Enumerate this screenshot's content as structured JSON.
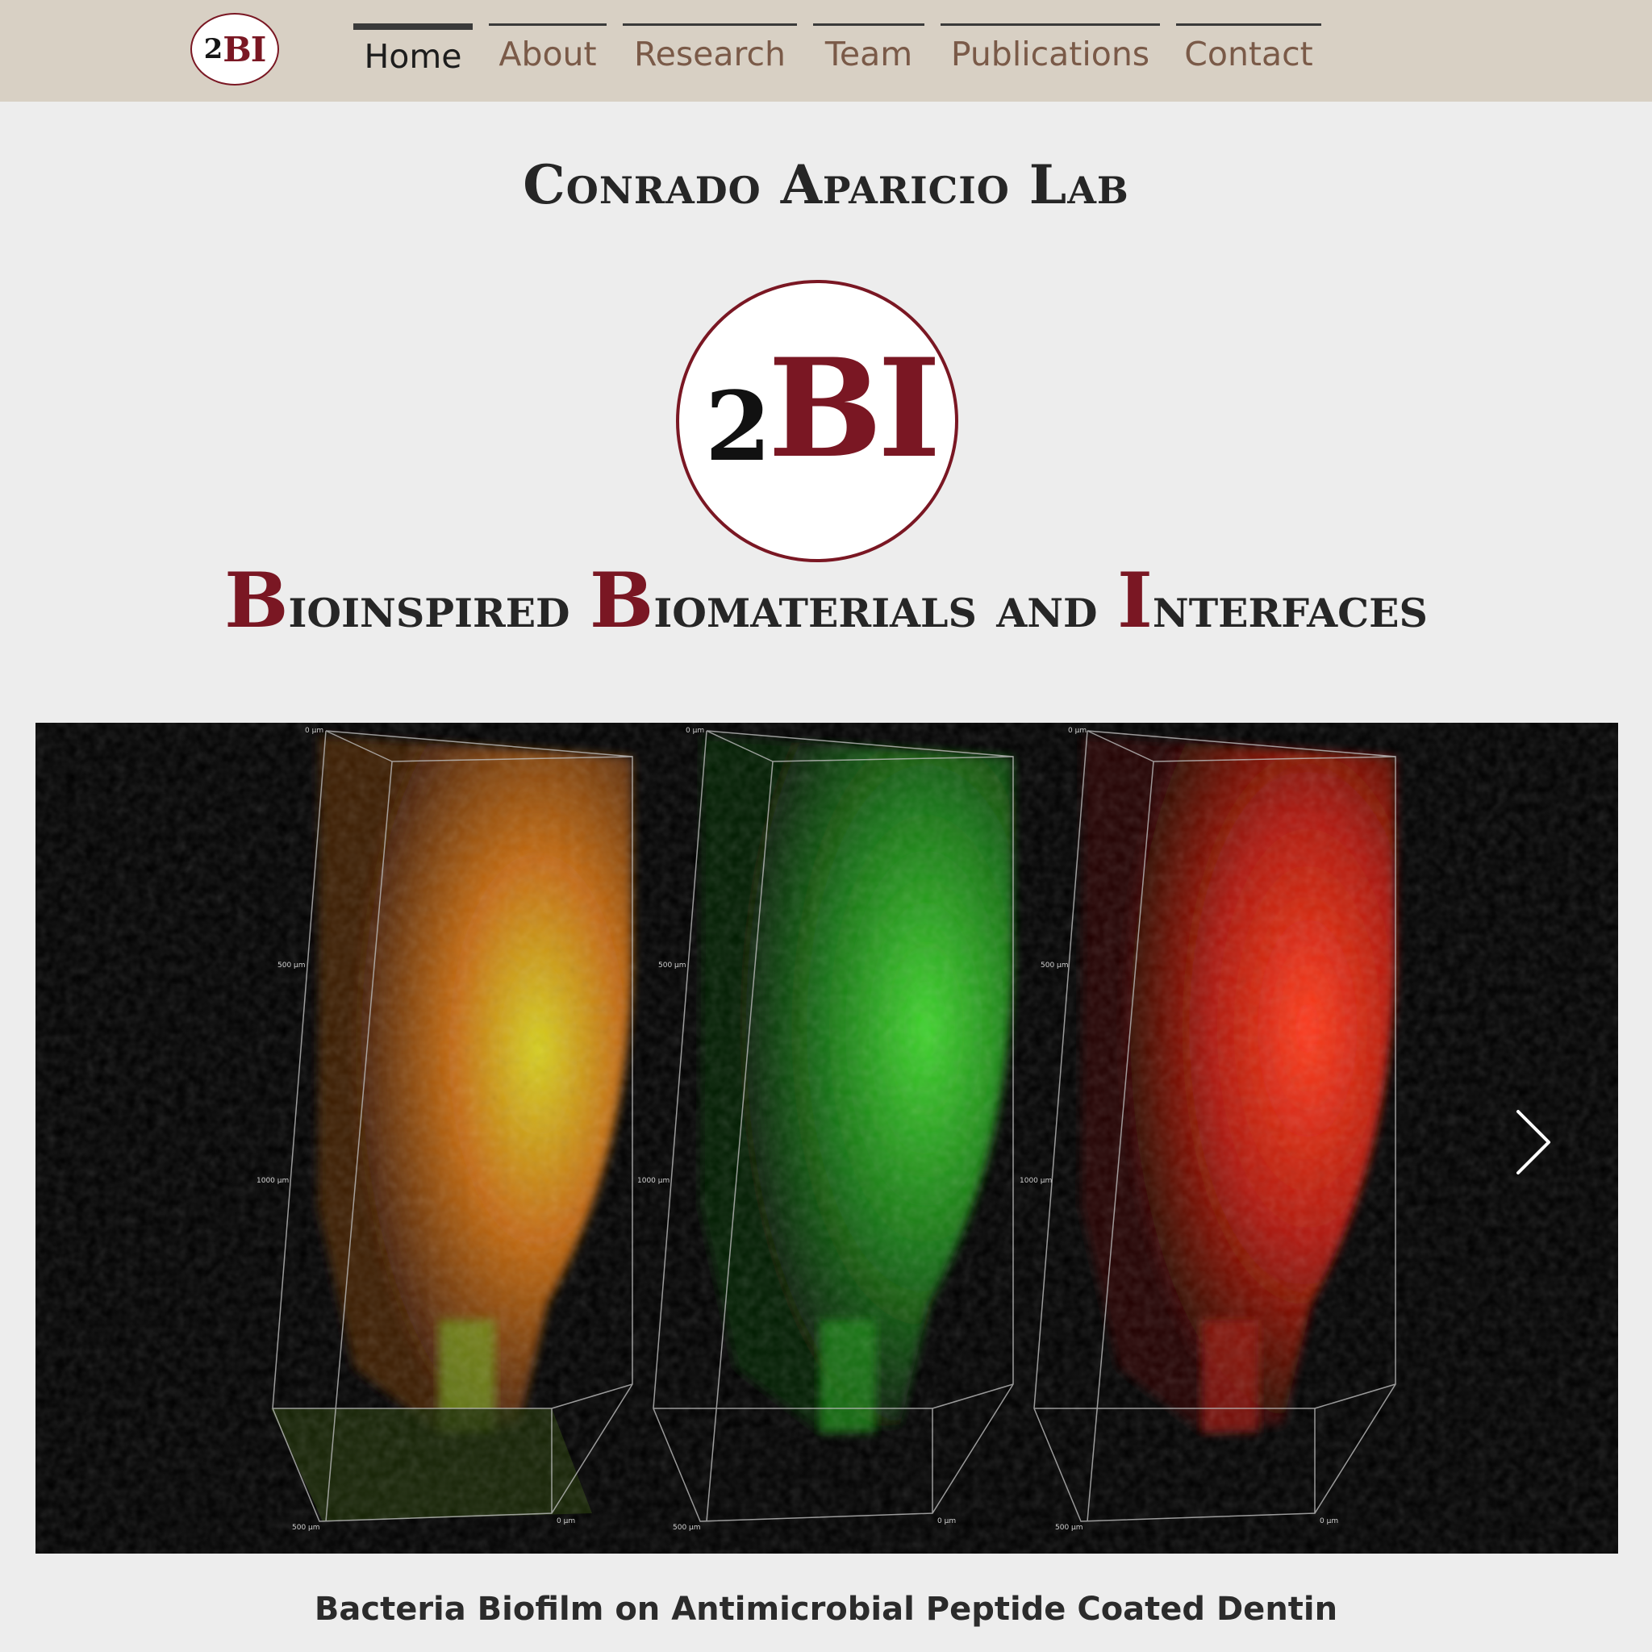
{
  "header": {
    "logo": {
      "two": "2",
      "bi": "BI"
    },
    "nav": [
      {
        "label": "Home",
        "active": true
      },
      {
        "label": "About",
        "active": false
      },
      {
        "label": "Research",
        "active": false
      },
      {
        "label": "Team",
        "active": false
      },
      {
        "label": "Publications",
        "active": false
      },
      {
        "label": "Contact",
        "active": false
      }
    ]
  },
  "site_title": "Conrado Aparicio Lab",
  "big_logo": {
    "two": "2",
    "bi": "BI"
  },
  "subtitle": {
    "words": [
      {
        "cap": "B",
        "rest": "ioinspired"
      },
      {
        "cap": "B",
        "rest": "iomaterials"
      },
      {
        "cap": "",
        "rest": "and"
      },
      {
        "cap": "I",
        "rest": "nterfaces"
      }
    ]
  },
  "slideshow": {
    "caption": "Bacteria Biofilm on Antimicrobial Peptide Coated Dentin",
    "next_icon": "chevron-right-icon",
    "axis_labels": {
      "top": "0 µm",
      "mid": "500 µm",
      "low": "1000 µm",
      "bottom": "500 µm",
      "corner": "0 µm"
    }
  },
  "colors": {
    "brand": "#7a1723",
    "header_bg": "#d8d0c4",
    "page_bg": "#ededed",
    "nav_text": "#7a5a48"
  }
}
